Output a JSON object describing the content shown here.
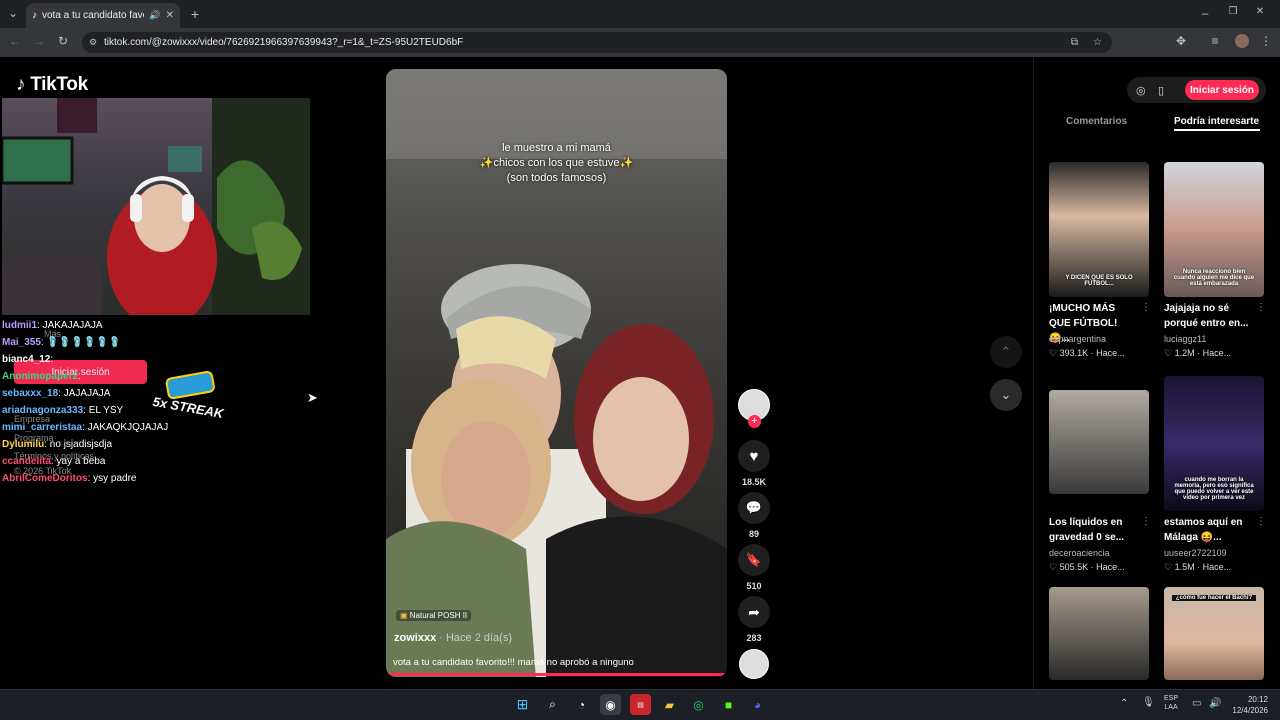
{
  "browser": {
    "tab_title": "vota a tu candidato favorito...",
    "new_tab": "+",
    "url": "tiktok.com/@zowixxx/video/7626921966397639943?_r=1&_t=ZS-95U2TEUD6bF",
    "window_controls": [
      "–",
      "❐",
      "✕"
    ]
  },
  "logo": "TikTok",
  "chat": [
    {
      "user": "ludmii1",
      "text": "JAKAJAJAJA",
      "color": "#b99cff"
    },
    {
      "user": "Mai_355",
      "text": "🩴🩴🩴🩴🩴🩴",
      "color": "#b99cff"
    },
    {
      "user": "bianc4_12",
      "text": "",
      "color": "#ffffff"
    },
    {
      "user": "Anonimopaper2",
      "text": "",
      "color": "#39d98a"
    },
    {
      "user": "sebaxxx_18",
      "text": "JAJAJAJA",
      "color": "#6ab7ff"
    },
    {
      "user": "ariadnagonza333",
      "text": "EL YSY",
      "color": "#6ab7ff"
    },
    {
      "user": "mimi_carreristaa",
      "text": "JAKAQKJQJAJAJ",
      "color": "#6ab7ff"
    },
    {
      "user": "Dylumilu",
      "text": "no jsjadisjsdja",
      "color": "#ffd84a"
    },
    {
      "user": "ccandelita",
      "text": "yay a beba",
      "color": "#ff4d6d"
    },
    {
      "user": "AbrilComeDoritos",
      "text": "ysy padre",
      "color": "#ff4d6d"
    }
  ],
  "sidebar_faint": {
    "more": "Más",
    "login_button": "Iniciar sesión",
    "company": "Empresa",
    "program": "Programa",
    "terms": "Términos y políticas",
    "copyright": "© 2026 TikTok"
  },
  "streak": "5x STREAK",
  "video": {
    "caption_lines": [
      "le muestro a mi mamá",
      "✨chicos con los que estuve✨",
      "(son todos famosos)"
    ],
    "music": "Natural POSH II",
    "author": "zowixxx",
    "time": " · Hace 2 día(s)",
    "description": "vota a tu candidato favorito!!! mamá no aprobó a ninguno"
  },
  "actions": {
    "likes": "18.5K",
    "comments": "89",
    "saves": "510",
    "shares": "283"
  },
  "right_panel": {
    "login": "Iniciar sesión",
    "tabs": [
      "Comentarios",
      "Podría interesarte"
    ],
    "cards": [
      {
        "title": "¡MUCHO MÁS QUE FÚTBOL! 😝...",
        "author": "espnargentina",
        "stats": "♡ 393.1K · Hace...",
        "thumb_text": "Y DICEN QUE ES SOLO FÚTBOL..."
      },
      {
        "title": "Jajajaja no sé porqué entro en...",
        "author": "luciaggz11",
        "stats": "♡ 1.2M · Hace...",
        "thumb_text": "Nunca reacciono bien cuando alguien me dice que está embarazada"
      },
      {
        "title": "Los líquidos en gravedad 0 se...",
        "author": "deceroaciencia",
        "stats": "♡ 505.5K · Hace...",
        "thumb_text": ""
      },
      {
        "title": "estamos aquí en Málaga 😝...",
        "author": "uuseer2722109",
        "stats": "♡ 1.5M · Hace...",
        "thumb_text": "cuando me borran la memoria, pero eso significa que puedo volver a ver este video por primera vez"
      },
      {
        "title": "",
        "author": "",
        "stats": "",
        "thumb_text": ""
      },
      {
        "title": "",
        "author": "",
        "stats": "",
        "thumb_text": "¿cómo fue hacer el Bachi?"
      }
    ]
  },
  "taskbar": {
    "lang": "ESP",
    "lang2": "LAA",
    "time": "20:12",
    "date": "12/4/2026"
  },
  "colors": {
    "accent": "#fe2c55"
  }
}
